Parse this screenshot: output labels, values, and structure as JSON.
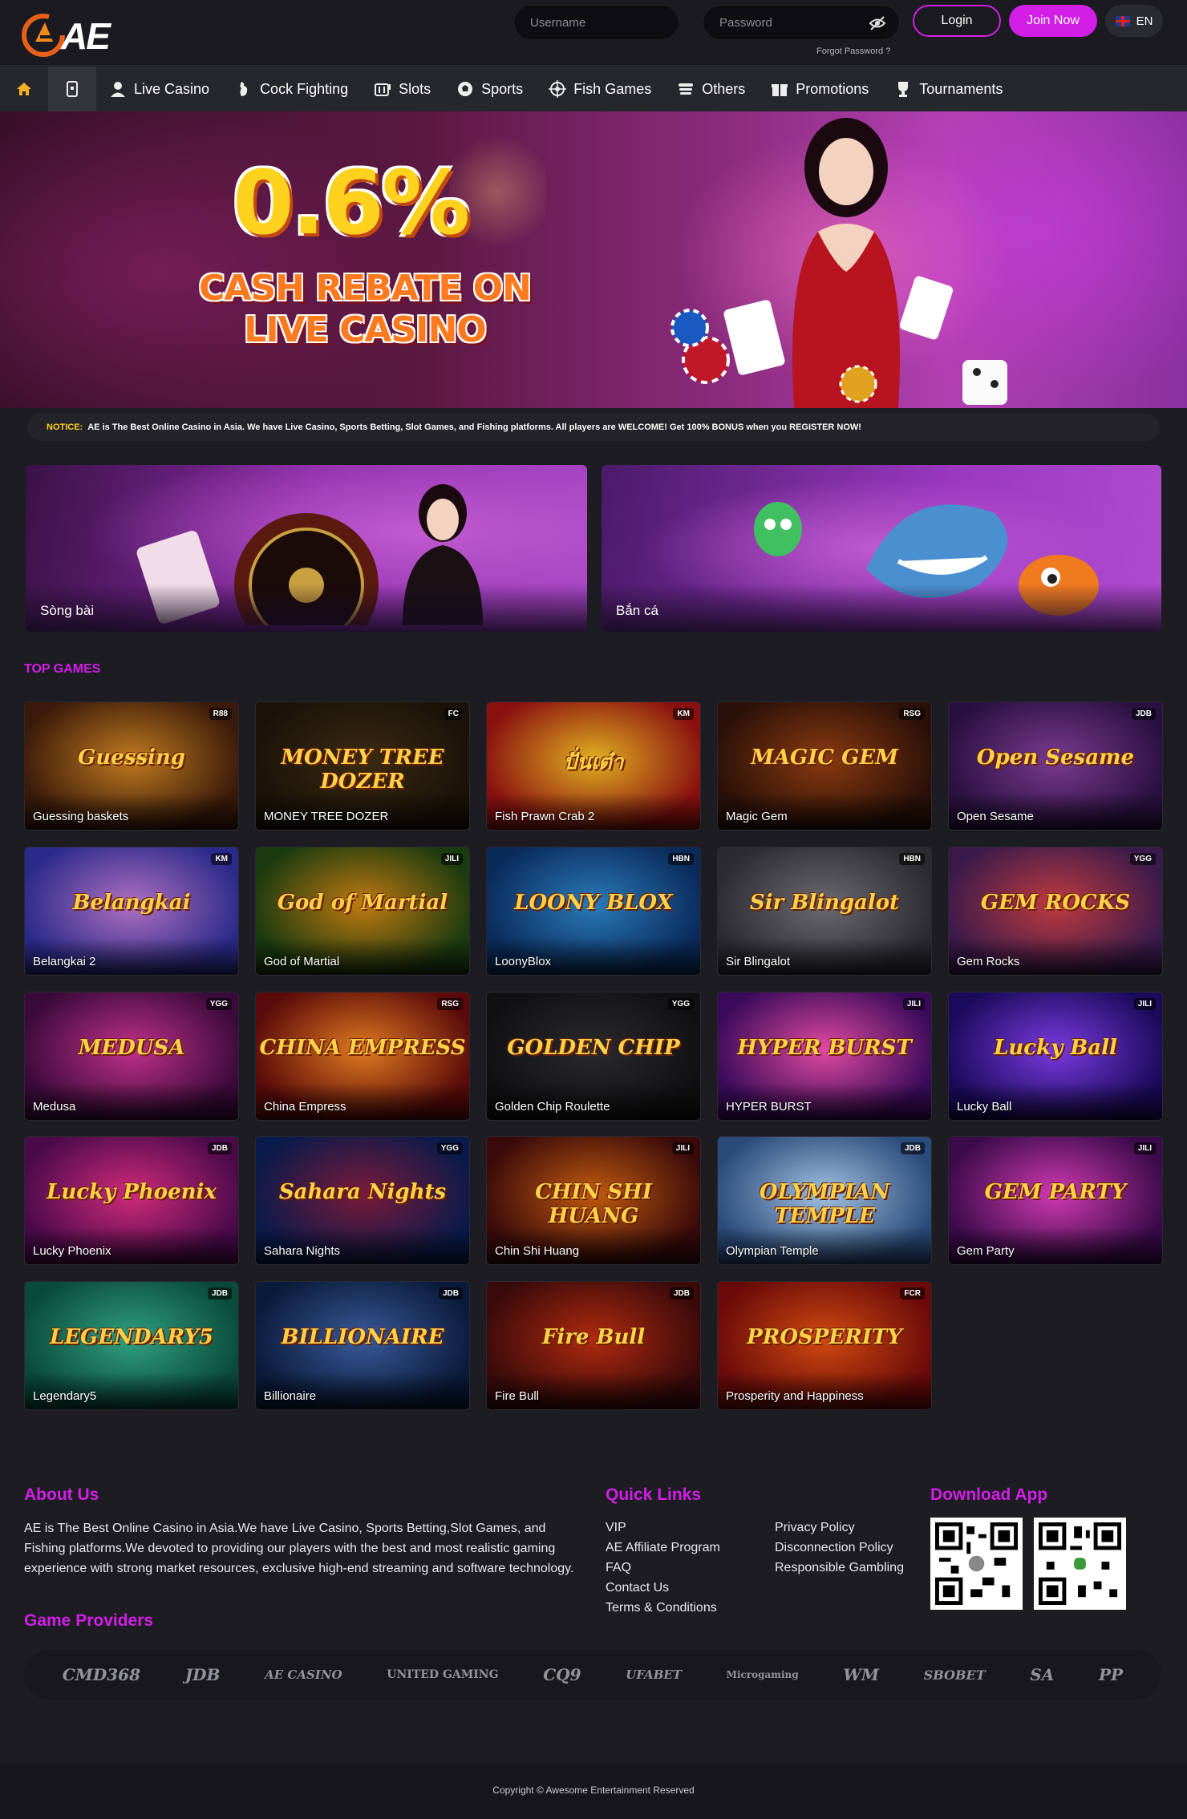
{
  "header": {
    "brand": "AE",
    "username_placeholder": "Username",
    "password_placeholder": "Password",
    "forgot_password": "Forgot Password ?",
    "login_label": "Login",
    "join_label": "Join Now",
    "language": "EN"
  },
  "nav": {
    "items": [
      {
        "label": "Live Casino",
        "icon": "dealer-icon"
      },
      {
        "label": "Cock Fighting",
        "icon": "rooster-icon"
      },
      {
        "label": "Slots",
        "icon": "slot-machine-icon"
      },
      {
        "label": "Sports",
        "icon": "soccer-ball-icon"
      },
      {
        "label": "Fish Games",
        "icon": "target-icon"
      },
      {
        "label": "Others",
        "icon": "stack-icon"
      },
      {
        "label": "Promotions",
        "icon": "gift-icon"
      },
      {
        "label": "Tournaments",
        "icon": "trophy-icon"
      }
    ]
  },
  "banner": {
    "headline": "0.6%",
    "subline_1": "CASH REBATE ON",
    "subline_2": "LIVE CASINO"
  },
  "notice": {
    "label": "NOTICE:",
    "text": "AE is The Best Online Casino in Asia. We have Live Casino, Sports Betting, Slot Games, and Fishing platforms. All players are WELCOME! Get 100% BONUS when you REGISTER NOW!"
  },
  "categories": [
    {
      "label": "Sòng bài"
    },
    {
      "label": "Bắn cá"
    }
  ],
  "top_games": {
    "title": "TOP GAMES",
    "games": [
      {
        "name": "Guessing baskets",
        "provider": "R88",
        "art": "Guessing",
        "c1": "#3a1a0a",
        "c2": "#c07a20"
      },
      {
        "name": "MONEY TREE DOZER",
        "provider": "FC",
        "art": "MONEY TREE DOZER",
        "c1": "#1a1208",
        "c2": "#3a2a10"
      },
      {
        "name": "Fish Prawn Crab 2",
        "provider": "KM",
        "art": "ปั่นเต๋า",
        "c1": "#8a1010",
        "c2": "#e0b020"
      },
      {
        "name": "Magic Gem",
        "provider": "RSG",
        "art": "MAGIC GEM",
        "c1": "#2a1008",
        "c2": "#8a3a10"
      },
      {
        "name": "Open Sesame",
        "provider": "JDB",
        "art": "Open Sesame",
        "c1": "#2a1040",
        "c2": "#7a3a90"
      },
      {
        "name": "Belangkai 2",
        "provider": "KM",
        "art": "Belangkai",
        "c1": "#2a2a8a",
        "c2": "#b070c0"
      },
      {
        "name": "God of Martial",
        "provider": "JILI",
        "art": "God of Martial",
        "c1": "#1a3a10",
        "c2": "#c07a10"
      },
      {
        "name": "LoonyBlox",
        "provider": "HBN",
        "art": "LOONY BLOX",
        "c1": "#0a2a5a",
        "c2": "#2a7aba"
      },
      {
        "name": "Sir Blingalot",
        "provider": "HBN",
        "art": "Sir Blingalot",
        "c1": "#2a2a30",
        "c2": "#6a6a70"
      },
      {
        "name": "Gem Rocks",
        "provider": "YGG",
        "art": "GEM ROCKS",
        "c1": "#3a1a4a",
        "c2": "#c03a40"
      },
      {
        "name": "Medusa",
        "provider": "YGG",
        "art": "MEDUSA",
        "c1": "#3a0a3a",
        "c2": "#c0308a"
      },
      {
        "name": "China Empress",
        "provider": "RSG",
        "art": "CHINA EMPRESS",
        "c1": "#5a0a0a",
        "c2": "#e07a20"
      },
      {
        "name": "Golden Chip Roulette",
        "provider": "YGG",
        "art": "GOLDEN CHIP",
        "c1": "#101012",
        "c2": "#2a2a2e"
      },
      {
        "name": "HYPER BURST",
        "provider": "JILI",
        "art": "HYPER BURST",
        "c1": "#3a0a5a",
        "c2": "#e04aa0"
      },
      {
        "name": "Lucky Ball",
        "provider": "JILI",
        "art": "Lucky Ball",
        "c1": "#1a0a5a",
        "c2": "#7a3ae0"
      },
      {
        "name": "Lucky Phoenix",
        "provider": "JDB",
        "art": "Lucky Phoenix",
        "c1": "#4a0a4a",
        "c2": "#d02a7a"
      },
      {
        "name": "Sahara Nights",
        "provider": "YGG",
        "art": "Sahara Nights",
        "c1": "#0a1a4a",
        "c2": "#7a1a3a"
      },
      {
        "name": "Chin Shi Huang",
        "provider": "JILI",
        "art": "CHIN SHI HUANG",
        "c1": "#3a0a0a",
        "c2": "#c05a10"
      },
      {
        "name": "Olympian Temple",
        "provider": "JDB",
        "art": "OLYMPIAN TEMPLE",
        "c1": "#2a4a7a",
        "c2": "#a0c0e0"
      },
      {
        "name": "Gem Party",
        "provider": "JILI",
        "art": "GEM PARTY",
        "c1": "#3a0a4a",
        "c2": "#d03ab0"
      },
      {
        "name": "Legendary5",
        "provider": "JDB",
        "art": "LEGENDARY5",
        "c1": "#0a4a3a",
        "c2": "#30a080"
      },
      {
        "name": "Billionaire",
        "provider": "JDB",
        "art": "BILLIONAIRE",
        "c1": "#0a1a3a",
        "c2": "#3a5a9a"
      },
      {
        "name": "Fire Bull",
        "provider": "JDB",
        "art": "Fire Bull",
        "c1": "#3a0a0a",
        "c2": "#b02a10"
      },
      {
        "name": "Prosperity and Happiness",
        "provider": "FCR",
        "art": "PROSPERITY",
        "c1": "#6a0a0a",
        "c2": "#d04a10"
      }
    ]
  },
  "footer": {
    "about_title": "About Us",
    "about_text": "AE is The Best Online Casino in Asia.We have Live Casino, Sports Betting,Slot Games, and Fishing platforms.We devoted to providing our players with the best and most realistic gaming experience with strong market resources, exclusive high-end streaming and software technology.",
    "quick_links_title": "Quick Links",
    "quick_links_col1": [
      "VIP",
      "AE Affiliate Program",
      "FAQ",
      "Contact Us",
      "Terms & Conditions"
    ],
    "quick_links_col2": [
      "Privacy Policy",
      "Disconnection Policy",
      "Responsible Gambling"
    ],
    "download_title": "Download App",
    "providers_title": "Game Providers",
    "providers": [
      "CMD368",
      "JDB",
      "AE CASINO",
      "UNITED GAMING",
      "CQ9",
      "UFABET",
      "Microgaming",
      "WM",
      "SBOBET",
      "SA",
      "PP"
    ],
    "copyright": "Copyright © Awesome Entertainment Reserved"
  },
  "colors": {
    "accent": "#d21ee6",
    "notice_label": "#ffd21e",
    "background": "#1c1c22"
  }
}
